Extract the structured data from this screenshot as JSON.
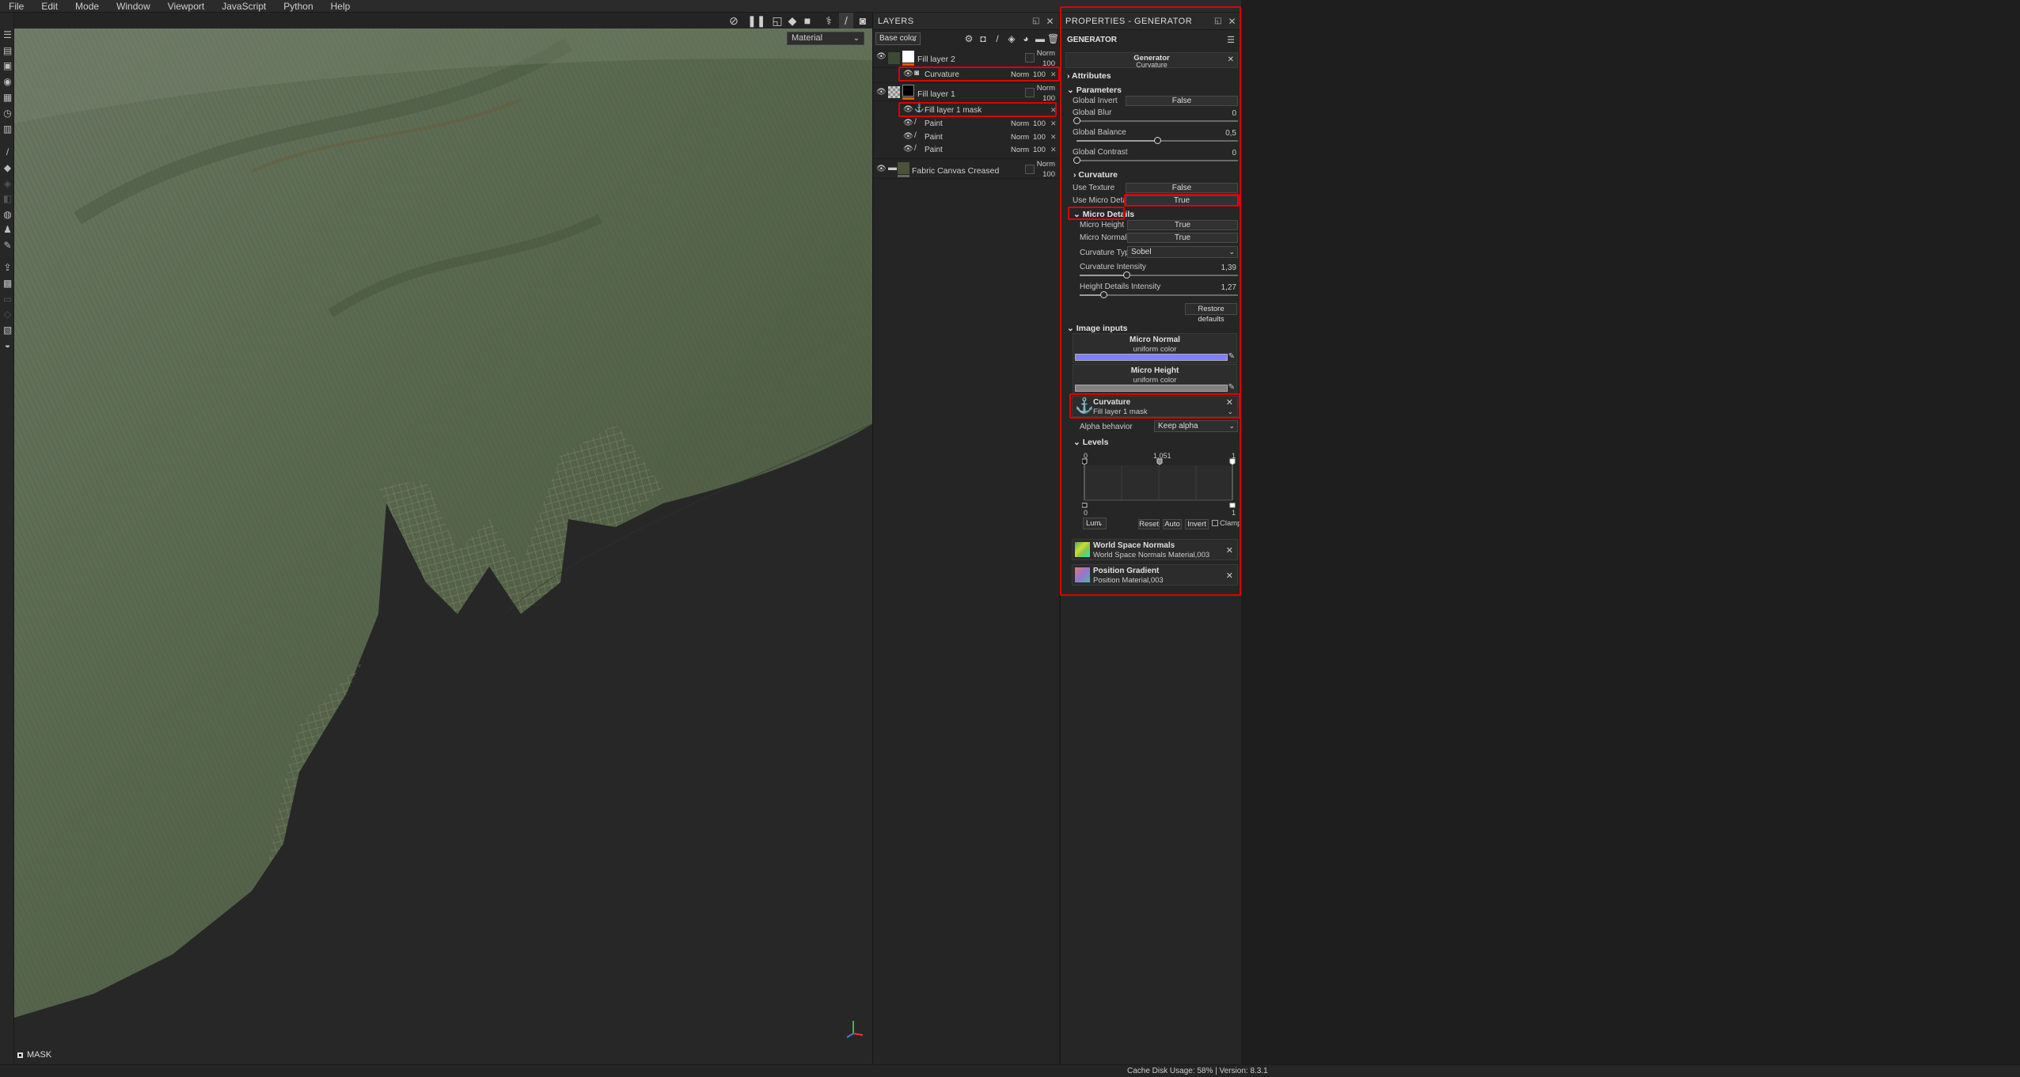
{
  "menu": [
    "File",
    "Edit",
    "Mode",
    "Window",
    "Viewport",
    "JavaScript",
    "Python",
    "Help"
  ],
  "viewport": {
    "material_select": "Material",
    "mask_label": "MASK"
  },
  "layers_panel": {
    "title": "LAYERS",
    "channel_select": "Base color",
    "rows": [
      {
        "name": "Fill layer 2",
        "blend": "Norm",
        "opacity": "100"
      },
      {
        "name": "Curvature",
        "blend": "Norm",
        "opacity": "100"
      },
      {
        "name": "Fill layer 1",
        "blend": "Norm",
        "opacity": "100"
      },
      {
        "name": "Fill layer 1 mask"
      },
      {
        "name": "Paint",
        "blend": "Norm",
        "opacity": "100"
      },
      {
        "name": "Paint",
        "blend": "Norm",
        "opacity": "100"
      },
      {
        "name": "Paint",
        "blend": "Norm",
        "opacity": "100"
      },
      {
        "name": "Fabric Canvas Creased",
        "blend": "Norm",
        "opacity": "100"
      }
    ]
  },
  "properties": {
    "title": "PROPERTIES - GENERATOR",
    "section": "GENERATOR",
    "generator_card": {
      "title": "Generator",
      "subtitle": "Curvature"
    },
    "attributes": "Attributes",
    "parameters": "Parameters",
    "global_invert": {
      "label": "Global Invert",
      "value": "False"
    },
    "global_blur": {
      "label": "Global Blur",
      "value": "0",
      "fraction": 0
    },
    "global_balance": {
      "label": "Global Balance",
      "value": "0,5",
      "fraction": 0.5
    },
    "global_contrast": {
      "label": "Global Contrast",
      "value": "0",
      "fraction": 0
    },
    "curvature_section": "Curvature",
    "use_texture": {
      "label": "Use Texture",
      "value": "False"
    },
    "use_micro_details": {
      "label": "Use Micro Details",
      "value": "True"
    },
    "micro_details": "Micro Details",
    "micro_height": {
      "label": "Micro Height",
      "value": "True"
    },
    "micro_normal": {
      "label": "Micro Normal",
      "value": "True"
    },
    "curvature_type": {
      "label": "Curvature Type",
      "value": "Sobel"
    },
    "curvature_intensity": {
      "label": "Curvature Intensity",
      "value": "1,39",
      "fraction": 0.295
    },
    "height_details_intensity": {
      "label": "Height Details Intensity",
      "value": "1,27",
      "fraction": 0.148
    },
    "restore_defaults": "Restore defaults",
    "image_inputs": "Image inputs",
    "micro_normal_input": {
      "title": "Micro Normal",
      "subtitle": "uniform color",
      "color": "#8080ff"
    },
    "micro_height_input": {
      "title": "Micro Height",
      "subtitle": "uniform color",
      "color": "#808080"
    },
    "curvature_input": {
      "title": "Curvature",
      "subtitle": "Fill layer 1 mask"
    },
    "alpha_behavior": {
      "label": "Alpha behavior",
      "value": "Keep alpha"
    },
    "levels": {
      "title": "Levels",
      "in_low": "0",
      "in_mid": "1,051",
      "in_high": "1",
      "out_low": "0",
      "out_high": "1",
      "mode": "Lum",
      "reset": "Reset",
      "auto": "Auto",
      "invert": "Invert",
      "clamp": "Clamp"
    },
    "world_space_normals": {
      "title": "World Space Normals",
      "subtitle": "World Space Normals Material,003"
    },
    "position_gradient": {
      "title": "Position Gradient",
      "subtitle": "Position Material,003"
    }
  },
  "status": "Cache Disk Usage:  58% | Version: 8.3.1",
  "colors": {
    "highlight": "#e00000",
    "micro_normal": "#8080ff",
    "micro_height": "#808080"
  }
}
